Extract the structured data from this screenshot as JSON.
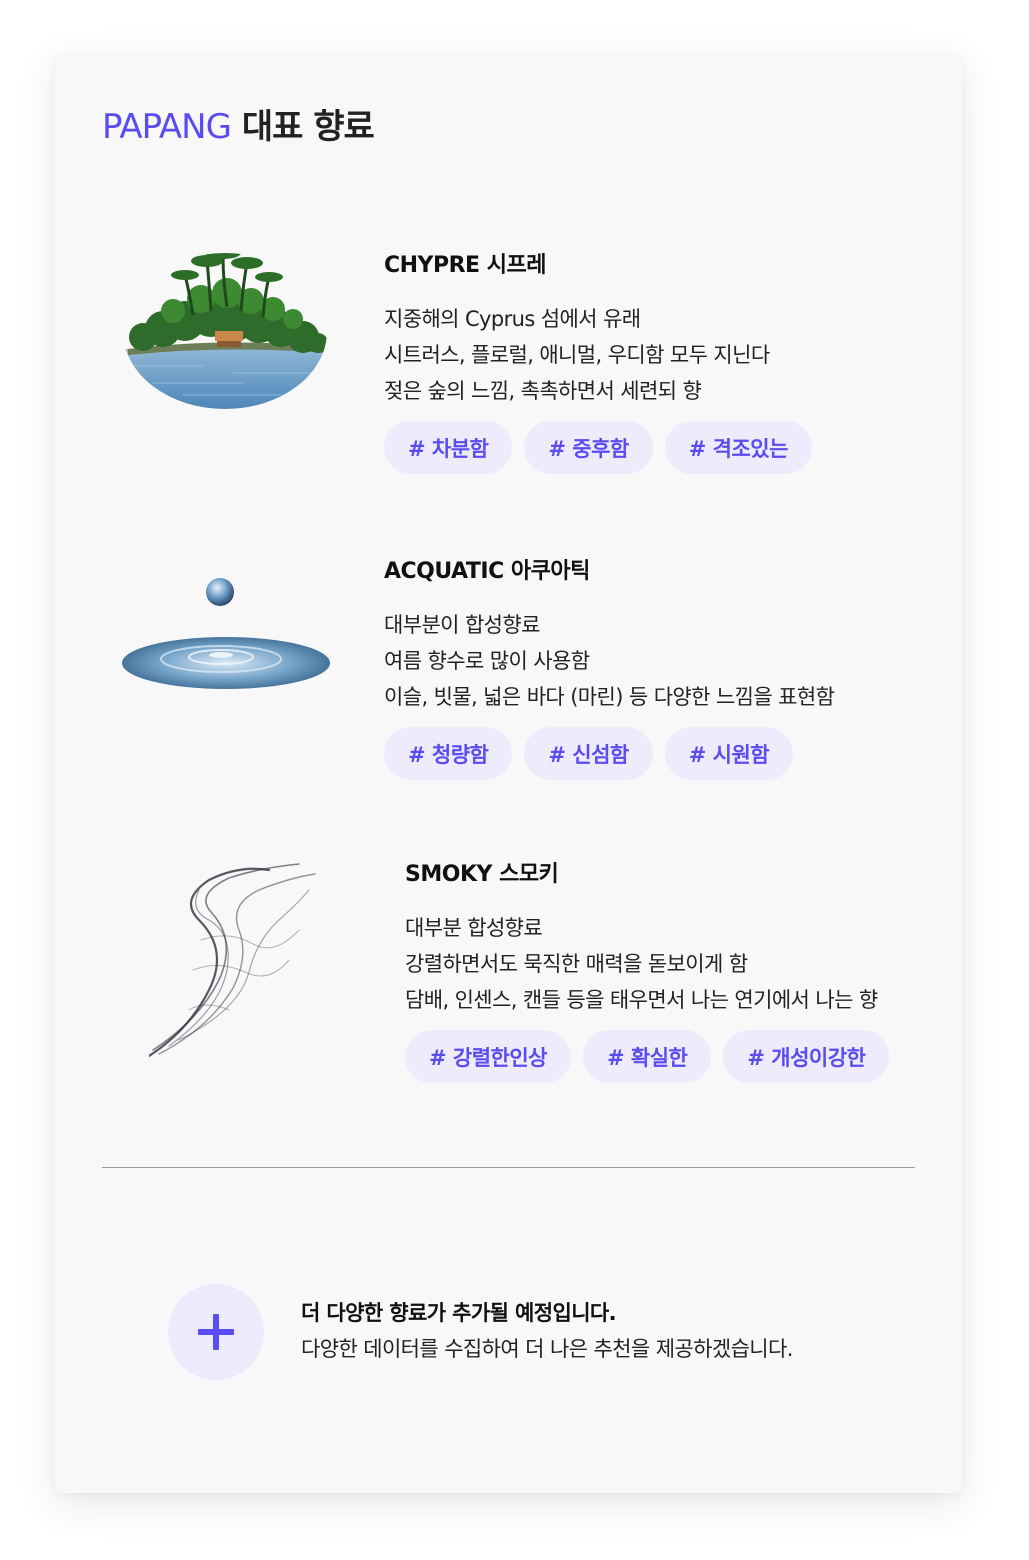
{
  "header": {
    "brand": "PAPANG",
    "title_rest": "대표 향료"
  },
  "colors": {
    "accent": "#5b4cf2",
    "tag_bg": "#eeebfd",
    "card_bg": "#f8f8f9"
  },
  "scents": [
    {
      "name": "CHYPRE 시프레",
      "image": "island-illustration",
      "lines": [
        "지중해의 Cyprus 섬에서 유래",
        "시트러스, 플로럴, 애니멀, 우디함 모두 지닌다",
        "젖은 숲의 느낌, 촉촉하면서 세련되 향"
      ],
      "tags": [
        "# 차분함",
        "# 중후함",
        "# 격조있는"
      ]
    },
    {
      "name": "ACQUATIC 아쿠아틱",
      "image": "water-drop-illustration",
      "lines": [
        "대부분이 합성향료",
        "여름 향수로 많이 사용함",
        "이슬, 빗물, 넓은 바다 (마린) 등 다양한 느낌을 표현함"
      ],
      "tags": [
        "# 청량함",
        "# 신섬함",
        "# 시원함"
      ]
    },
    {
      "name": "SMOKY 스모키",
      "image": "smoke-illustration",
      "lines": [
        "대부분 합성향료",
        "강렬하면서도 묵직한 매력을 돋보이게 함",
        "담배, 인센스, 캔들 등을 태우면서 나는 연기에서 나는 향"
      ],
      "tags": [
        "# 강렬한인상",
        "# 확실한",
        "# 개성이강한"
      ]
    }
  ],
  "footer": {
    "icon": "plus-icon",
    "line1": "더 다양한 향료가 추가될 예정입니다.",
    "line2": "다양한 데이터를 수집하여 더 나은 추천을 제공하겠습니다."
  }
}
